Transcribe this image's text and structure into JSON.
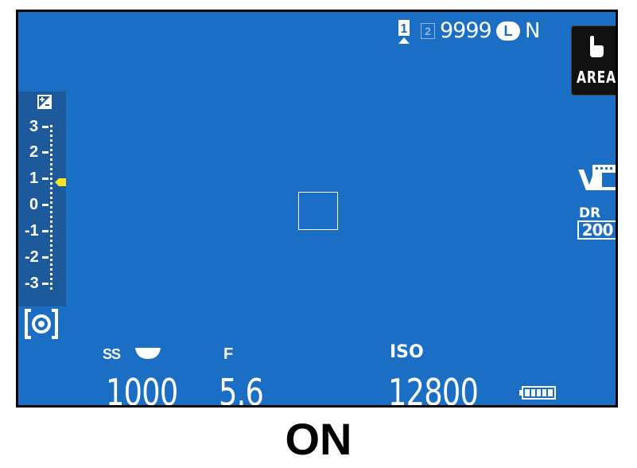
{
  "status": {
    "slot1": "1",
    "slot2": "2",
    "shots_remaining": "9999",
    "image_size": "L",
    "image_quality": "N"
  },
  "touch": {
    "icon": "touch-hand-icon",
    "label": "AREA"
  },
  "exposure_comp": {
    "icon": "exposure-compensation-icon",
    "scale": [
      "3",
      "2",
      "1",
      "0",
      "-1",
      "-2",
      "-3"
    ],
    "value": 1
  },
  "metering": {
    "icon": "multi-metering-icon"
  },
  "film_simulation": {
    "icon": "film-simulation-velvia-icon",
    "label": "V"
  },
  "dynamic_range": {
    "label": "DR",
    "value": "200"
  },
  "shooting": {
    "ss_label": "SS",
    "shutter_speed": "1000",
    "f_label": "F",
    "aperture": "5.6",
    "iso_label": "ISO",
    "iso": "12800"
  },
  "battery": {
    "icon": "battery-full-icon",
    "level": 1.0
  },
  "caption": "ON",
  "colors": {
    "lcd_background": "#1a6ec3",
    "indicator_yellow": "#f5e02a",
    "touch_panel": "#111111"
  }
}
